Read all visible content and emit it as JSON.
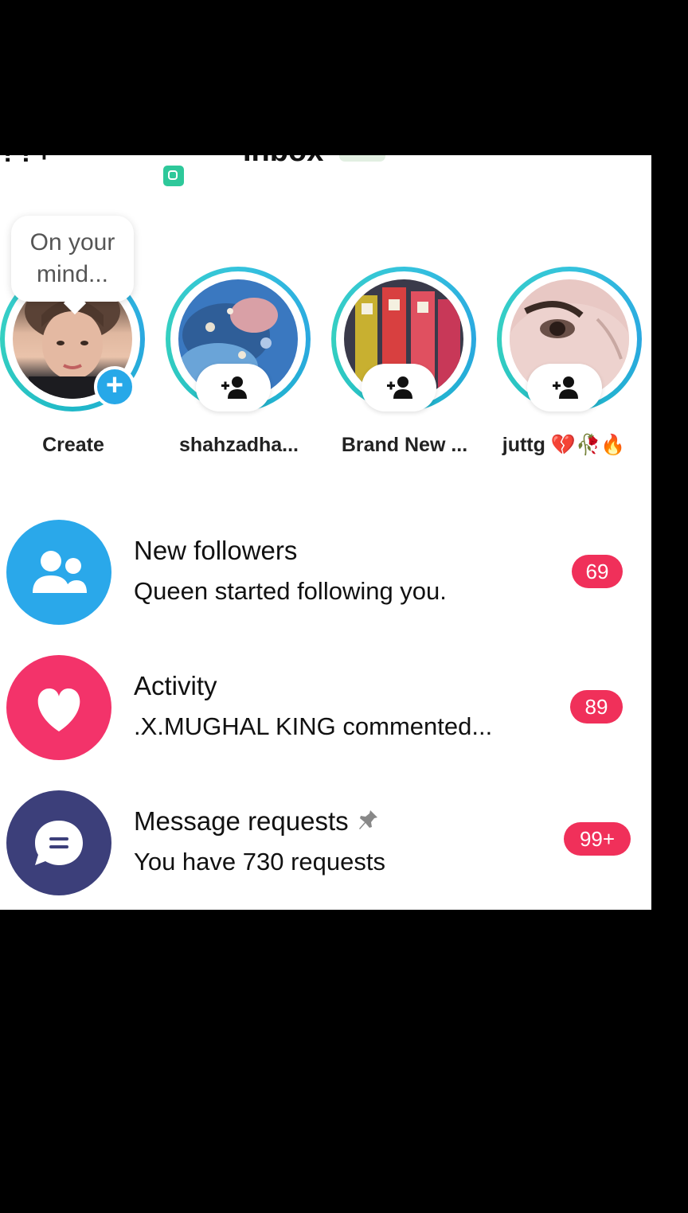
{
  "header": {
    "left_text": "??+",
    "title": "Inbox"
  },
  "composer_prompt": "On your\nmind...",
  "stories": [
    {
      "name": "Create",
      "type": "create"
    },
    {
      "name": "shahzadha...",
      "type": "suggested"
    },
    {
      "name": "Brand New ...",
      "type": "suggested"
    },
    {
      "name": "juttg 💔🥀🔥",
      "type": "suggested"
    }
  ],
  "rows": [
    {
      "title": "New followers",
      "subtitle": "Queen started following you.",
      "badge": "69",
      "icon": "people-icon",
      "color": "#2aa8ea"
    },
    {
      "title": "Activity",
      "subtitle": ".X.MUGHAL KING commented...",
      "badge": "89",
      "icon": "heart-icon",
      "color": "#f3336a"
    },
    {
      "title": "Message requests",
      "subtitle": "You have 730 requests",
      "badge": "99+",
      "icon": "message-icon",
      "color": "#3c3f7a"
    }
  ],
  "colors": {
    "accent": "#2aa8ea",
    "badge": "#f0305a",
    "ring": "#35c3dd"
  }
}
